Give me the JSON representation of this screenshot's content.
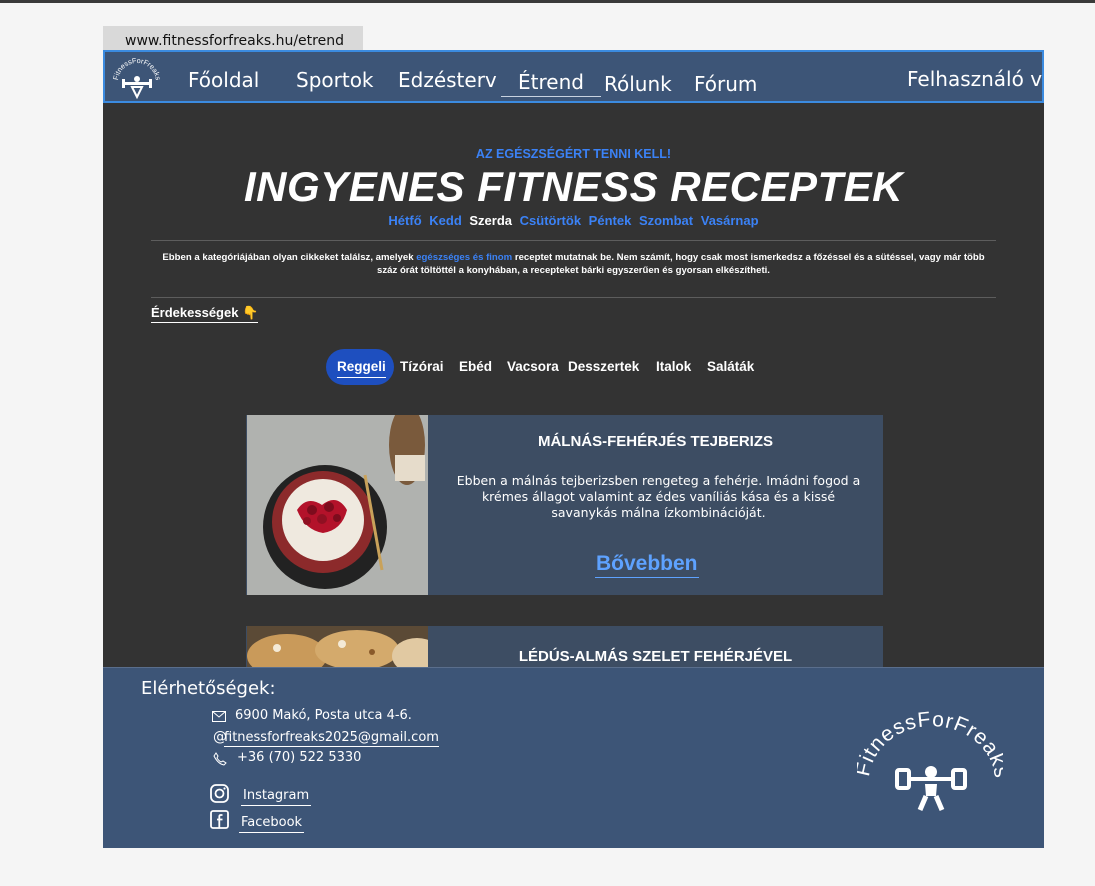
{
  "browser": {
    "url": "www.fitnessforfreaks.hu/etrend"
  },
  "brand": {
    "name": "FitnessForFreaks",
    "accent": "#3b82f6",
    "nav_bg": "#3d5577",
    "page_bg": "#333333"
  },
  "nav": {
    "items": [
      "Főoldal",
      "Sportok",
      "Edzésterv",
      "Étrend",
      "Rólunk",
      "Fórum"
    ],
    "active": "Étrend",
    "user": "Felhasználó v"
  },
  "hero": {
    "kicker": "AZ EGÉSZSÉGÉRT TENNI KELL!",
    "title": "INGYENES FITNESS RECEPTEK",
    "days": [
      "Hétfő",
      "Kedd",
      "Szerda",
      "Csütörtök",
      "Péntek",
      "Szombat",
      "Vasárnap"
    ],
    "selected_day": "Szerda"
  },
  "intro": {
    "part1": "Ebben a kategóriájában olyan cikkeket találsz, amelyek ",
    "highlight": "egészséges és finom",
    "part2": " receptet mutatnak be. Nem számít, hogy csak most ismerkedsz a főzéssel és a sütéssel, vagy már több száz órát töltöttél a konyhában, a recepteket bárki egyszerűen és gyorsan elkészítheti."
  },
  "interest": {
    "label": "Érdekességek 👇"
  },
  "categories": {
    "items": [
      "Reggeli",
      "Tízórai",
      "Ebéd",
      "Vacsora",
      "Desszertek",
      "Italok",
      "Saláták"
    ],
    "active": "Reggeli"
  },
  "recipes": [
    {
      "title": "MÁLNÁS-FEHÉRJÉS TEJBERIZS",
      "description": "Ebben a málnás tejberizsben rengeteg a fehérje. Imádni fogod a krémes állagot valamint az édes vaníliás kása és a kissé savanykás málna ízkombinációját.",
      "more": "Bővebben"
    },
    {
      "title": "LÉDÚS-ALMÁS SZELET FEHÉRJÉVEL"
    }
  ],
  "footer": {
    "title": "Elérhetőségek:",
    "address": "6900 Makó, Posta utca 4-6.",
    "email": "fitnessforfreaks2025@gmail.com",
    "phone": "+36 (70) 522 5330",
    "instagram": "Instagram",
    "facebook": "Facebook",
    "logo_text": "FitnessForFreaks"
  }
}
